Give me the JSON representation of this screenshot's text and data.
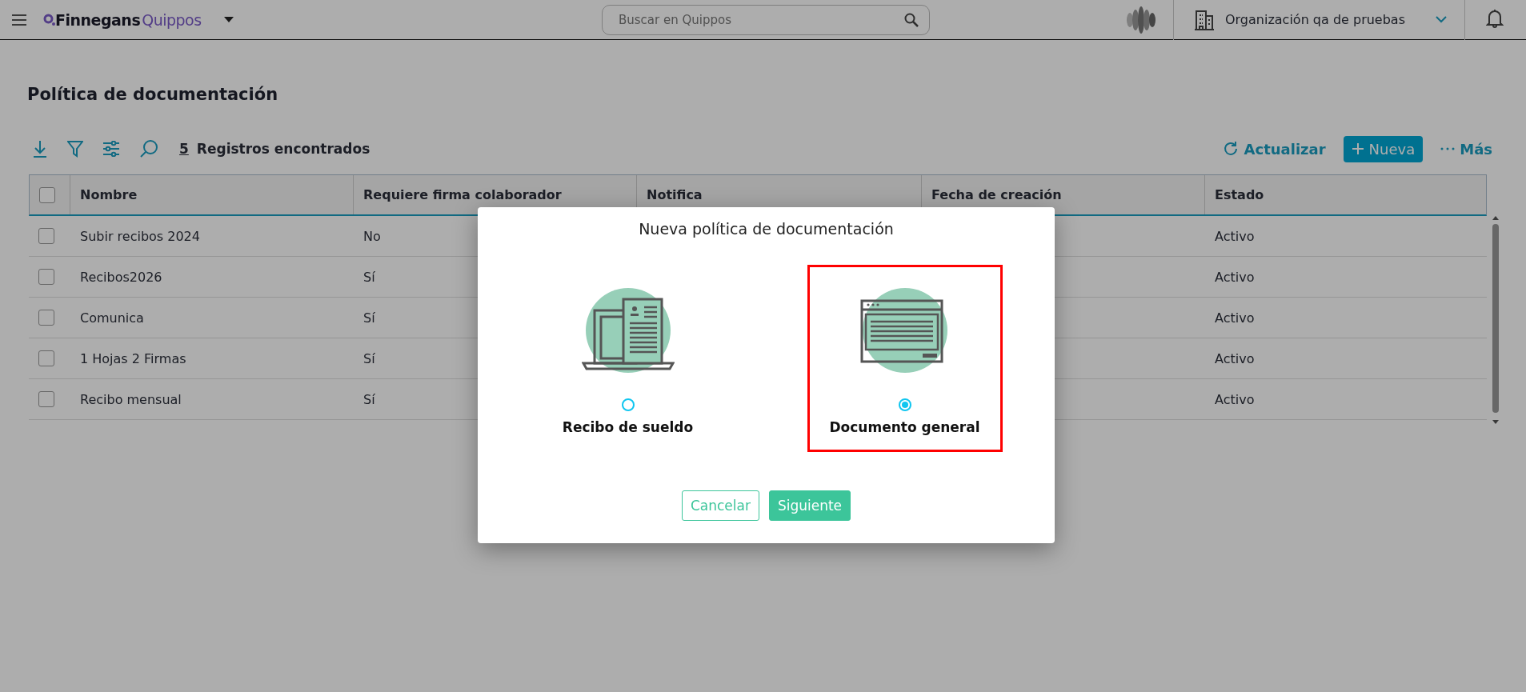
{
  "topbar": {
    "brand": [
      "Finnegans",
      "Quippos"
    ],
    "search": {
      "placeholder": "Buscar en Quippos"
    },
    "organization": "Organización qa de pruebas"
  },
  "page": {
    "title": "Política de documentación",
    "records": {
      "count": "5",
      "label": "Registros encontrados"
    },
    "actions": [
      {
        "label": "Actualizar",
        "kind": "refresh"
      },
      {
        "label": "Nueva",
        "kind": "primary"
      },
      {
        "label": "Más",
        "kind": "more"
      }
    ]
  },
  "table": {
    "all_checked": false,
    "columns": [
      "Nombre",
      "Requiere firma colaborador",
      "Notifica",
      "Fecha de creación",
      "Estado"
    ],
    "rows": [
      {
        "nombre": "Subir recibos 2024",
        "requiere_firma": "No",
        "estado": "Activo",
        "checked": false
      },
      {
        "nombre": "Recibos2026",
        "requiere_firma": "Sí",
        "estado": "Activo",
        "checked": false
      },
      {
        "nombre": "Comunica",
        "requiere_firma": "Sí",
        "estado": "Activo",
        "checked": false
      },
      {
        "nombre": "1 Hojas 2 Firmas",
        "requiere_firma": "Sí",
        "estado": "Activo",
        "checked": false
      },
      {
        "nombre": "Recibo mensual",
        "requiere_firma": "Sí",
        "estado": "Activo",
        "checked": false
      }
    ]
  },
  "dialog": {
    "title": "Nueva política de documentación",
    "options": [
      {
        "label": "Recibo de sueldo",
        "kind": "receipt",
        "selected": false
      },
      {
        "label": "Documento general",
        "kind": "document",
        "selected": true
      }
    ],
    "buttons": [
      {
        "label": "Cancelar",
        "kind": "secondary"
      },
      {
        "label": "Siguiente",
        "kind": "primary"
      }
    ]
  }
}
